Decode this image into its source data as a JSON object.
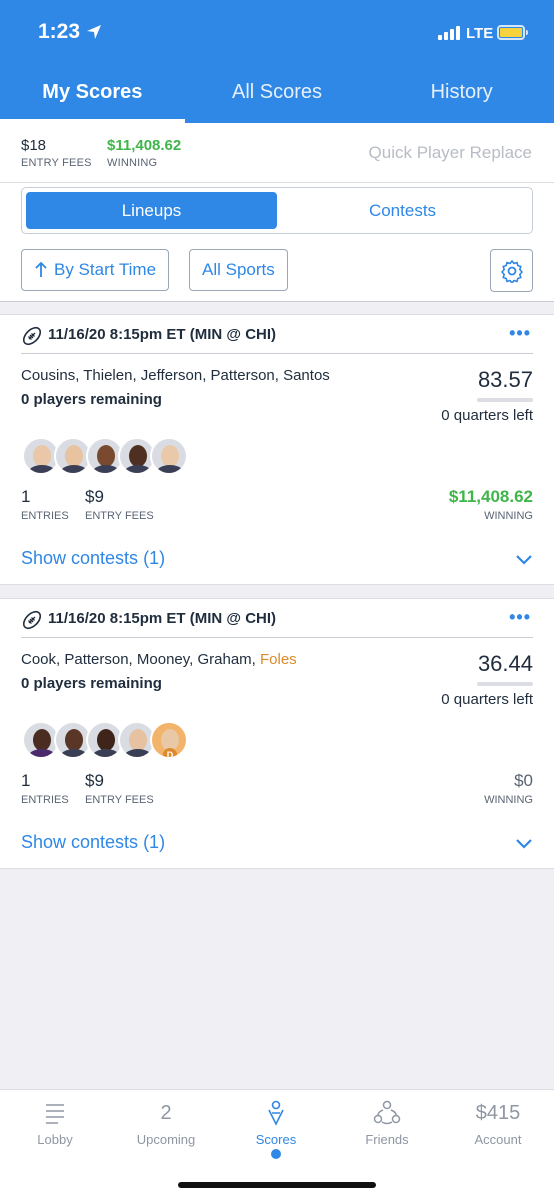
{
  "status_bar": {
    "time": "1:23",
    "network": "LTE"
  },
  "tabs": [
    {
      "label": "My Scores",
      "active": true
    },
    {
      "label": "All Scores",
      "active": false
    },
    {
      "label": "History",
      "active": false
    }
  ],
  "summary": {
    "entry_fees_value": "$18",
    "entry_fees_label": "ENTRY FEES",
    "winning_value": "$11,408.62",
    "winning_label": "WINNING",
    "quick_replace": "Quick Player Replace"
  },
  "segment": {
    "lineups": "Lineups",
    "contests": "Contests"
  },
  "filters": {
    "sort": "By Start Time",
    "sports": "All Sports"
  },
  "cards": [
    {
      "title": "11/16/20 8:15pm ET (MIN @ CHI)",
      "players": "Cousins, Thielen, Jefferson, Patterson, Santos",
      "players_orange": "",
      "remaining": "0 players remaining",
      "score": "83.57",
      "quarters_left": "0 quarters left",
      "entries_value": "1",
      "entries_label": "ENTRIES",
      "fees_value": "$9",
      "fees_label": "ENTRY FEES",
      "winning_value": "$11,408.62",
      "winning_label": "WINNING",
      "show_contests": "Show contests (1)"
    },
    {
      "title": "11/16/20 8:15pm ET (MIN @ CHI)",
      "players": "Cook, Patterson, Mooney, Graham, ",
      "players_orange": "Foles",
      "remaining": "0 players remaining",
      "score": "36.44",
      "quarters_left": "0 quarters left",
      "entries_value": "1",
      "entries_label": "ENTRIES",
      "fees_value": "$9",
      "fees_label": "ENTRY FEES",
      "winning_value": "$0",
      "winning_label": "WINNING",
      "show_contests": "Show contests (1)"
    }
  ],
  "bottom_nav": [
    {
      "label": "Lobby",
      "icon": "list-icon",
      "active": false
    },
    {
      "label": "Upcoming",
      "badge": "2",
      "active": false
    },
    {
      "label": "Scores",
      "icon": "scores-icon",
      "active": true
    },
    {
      "label": "Friends",
      "icon": "friends-icon",
      "active": false
    },
    {
      "label": "Account",
      "badge": "$415",
      "active": false
    }
  ],
  "colors": {
    "brand_blue": "#2f87e6",
    "winning_green": "#3fb54a",
    "late_swap_orange": "#de8a2b"
  }
}
